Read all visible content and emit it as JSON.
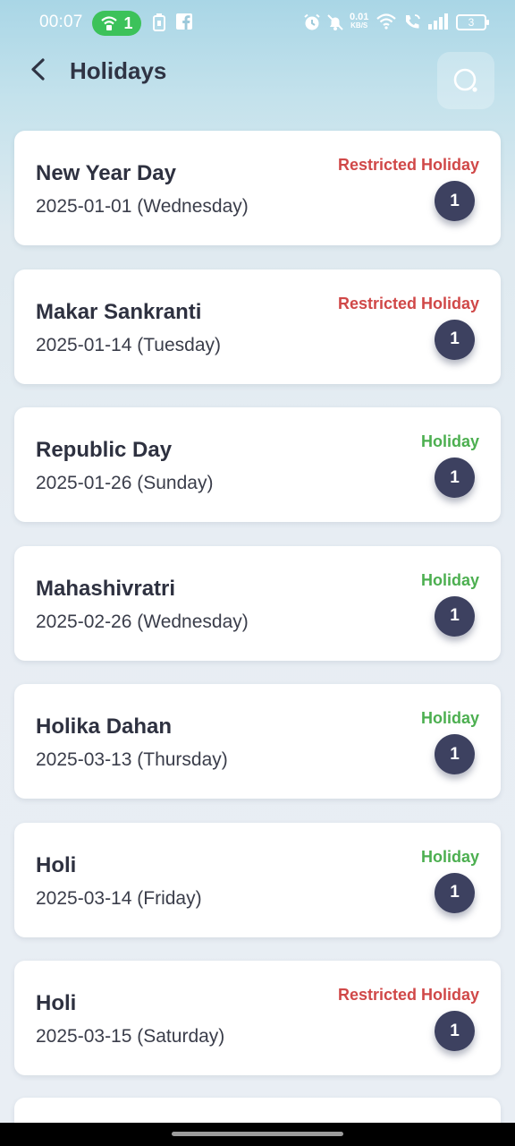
{
  "status_bar": {
    "time": "00:07",
    "hotspot_count": "1",
    "speed_value": "0.01",
    "speed_unit": "KB/S",
    "battery": "3",
    "icons": [
      "hotspot-icon",
      "battery-saver-icon",
      "facebook-icon",
      "alarm-icon",
      "mute-icon",
      "wifi-icon",
      "wifi-call-icon",
      "signal-icon",
      "battery-icon"
    ]
  },
  "header": {
    "title": "Holidays",
    "back_icon": "chevron-left-icon",
    "search_icon": "search-icon"
  },
  "colors": {
    "restricted": "#d04848",
    "holiday": "#4caf50",
    "badge": "#3d4160",
    "title_text": "#2f3444"
  },
  "holidays": [
    {
      "name": "New Year Day",
      "date": "2025-01-01 (Wednesday)",
      "type": "Restricted Holiday",
      "count": "1"
    },
    {
      "name": "Makar Sankranti",
      "date": "2025-01-14 (Tuesday)",
      "type": "Restricted Holiday",
      "count": "1"
    },
    {
      "name": "Republic Day",
      "date": "2025-01-26 (Sunday)",
      "type": "Holiday",
      "count": "1"
    },
    {
      "name": "Mahashivratri",
      "date": "2025-02-26 (Wednesday)",
      "type": "Holiday",
      "count": "1"
    },
    {
      "name": "Holika Dahan",
      "date": "2025-03-13 (Thursday)",
      "type": "Holiday",
      "count": "1"
    },
    {
      "name": "Holi",
      "date": "2025-03-14 (Friday)",
      "type": "Holiday",
      "count": "1"
    },
    {
      "name": "Holi",
      "date": "2025-03-15 (Saturday)",
      "type": "Restricted Holiday",
      "count": "1"
    }
  ]
}
